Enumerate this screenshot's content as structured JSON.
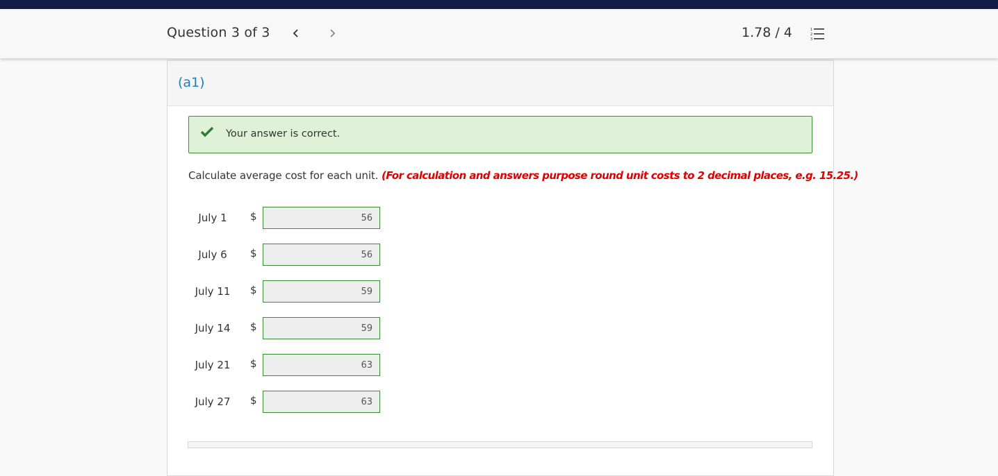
{
  "header": {
    "question_title": "Question 3 of 3",
    "prev_icon": "chevron-left-icon",
    "next_icon": "chevron-right-icon",
    "score": "1.78 / 4",
    "list_icon": "numbered-list-icon"
  },
  "part": {
    "label": "(a1)"
  },
  "alert": {
    "icon": "checkmark-icon",
    "text": "Your answer is correct.",
    "color": "#3b8a38",
    "background": "#dff1d7"
  },
  "instruction": {
    "text": "Calculate average cost for each unit.",
    "note": "(For calculation and answers purpose round unit costs to 2 decimal places, e.g. 15.25.)",
    "note_color": "#e00000"
  },
  "answers": [
    {
      "label": "July 1",
      "currency": "$",
      "value": "56"
    },
    {
      "label": "July 6",
      "currency": "$",
      "value": "56"
    },
    {
      "label": "July 11",
      "currency": "$",
      "value": "59"
    },
    {
      "label": "July 14",
      "currency": "$",
      "value": "59"
    },
    {
      "label": "July 21",
      "currency": "$",
      "value": "63"
    },
    {
      "label": "July 27",
      "currency": "$",
      "value": "63"
    }
  ],
  "colors": {
    "top_bar": "#131c44",
    "link": "#1a7fc1"
  }
}
